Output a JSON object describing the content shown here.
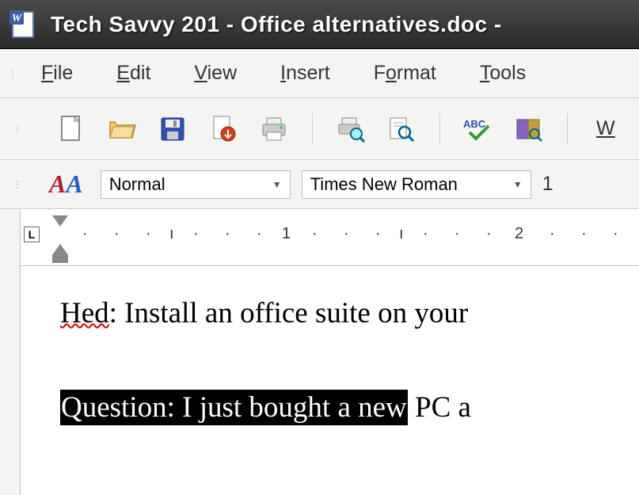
{
  "title": "Tech Savvy 201 - Office alternatives.doc -",
  "menu": {
    "file": "File",
    "edit": "Edit",
    "view": "View",
    "insert": "Insert",
    "format": "Format",
    "tools": "Tools"
  },
  "toolbar": {
    "new": "New",
    "open": "Open",
    "save": "Save",
    "export_pdf": "Export PDF",
    "print_direct": "Print",
    "preview": "Print Preview",
    "find": "Find",
    "spell": "Spellcheck",
    "autoformat": "AutoFormat",
    "web_label": "W"
  },
  "format": {
    "style_value": "Normal",
    "font_value": "Times New Roman",
    "size_value": "1"
  },
  "ruler": {
    "num1": "1",
    "num2": "2"
  },
  "document": {
    "line1_word1": "Hed",
    "line1_rest": ": Install an office suite on your",
    "line2_selected": "Question: I just bought a new",
    "line2_rest": " PC a"
  }
}
